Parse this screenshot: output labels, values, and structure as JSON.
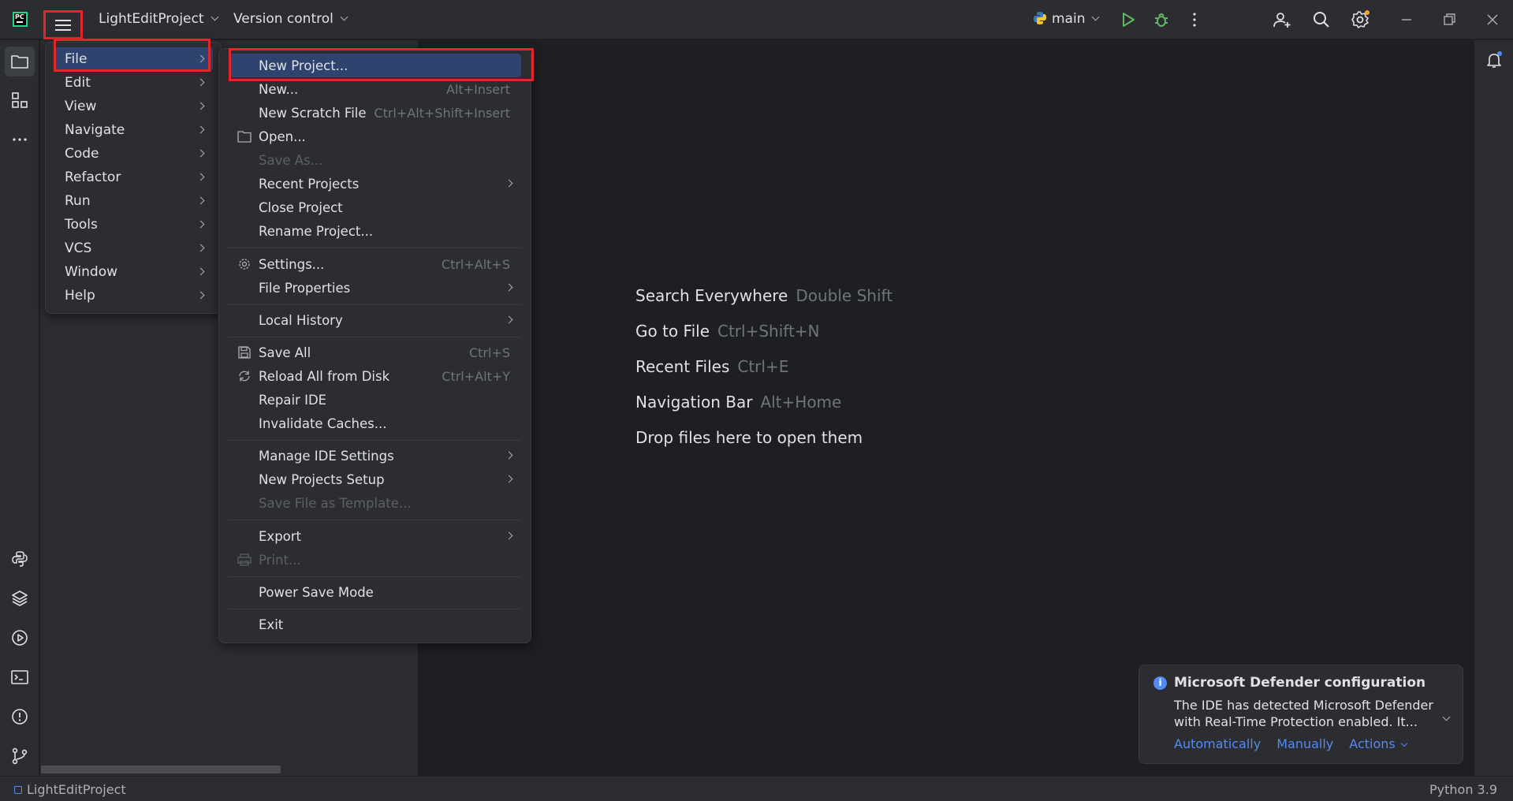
{
  "titlebar": {
    "project_name": "LightEditProject",
    "version_control": "Version control",
    "branch": "main"
  },
  "main_menu": {
    "items": [
      {
        "label": "File",
        "selected": true
      },
      {
        "label": "Edit"
      },
      {
        "label": "View"
      },
      {
        "label": "Navigate"
      },
      {
        "label": "Code"
      },
      {
        "label": "Refactor"
      },
      {
        "label": "Run"
      },
      {
        "label": "Tools"
      },
      {
        "label": "VCS"
      },
      {
        "label": "Window"
      },
      {
        "label": "Help"
      }
    ]
  },
  "file_menu": {
    "new_project": "New Project...",
    "new": "New...",
    "new_shortcut": "Alt+Insert",
    "new_scratch": "New Scratch File",
    "new_scratch_shortcut": "Ctrl+Alt+Shift+Insert",
    "open": "Open...",
    "save_as": "Save As...",
    "recent_projects": "Recent Projects",
    "close_project": "Close Project",
    "rename_project": "Rename Project...",
    "settings": "Settings...",
    "settings_shortcut": "Ctrl+Alt+S",
    "file_properties": "File Properties",
    "local_history": "Local History",
    "save_all": "Save All",
    "save_all_shortcut": "Ctrl+S",
    "reload": "Reload All from Disk",
    "reload_shortcut": "Ctrl+Alt+Y",
    "repair_ide": "Repair IDE",
    "invalidate_caches": "Invalidate Caches...",
    "manage_ide_settings": "Manage IDE Settings",
    "new_projects_setup": "New Projects Setup",
    "save_template": "Save File as Template...",
    "export": "Export",
    "print": "Print...",
    "power_save": "Power Save Mode",
    "exit": "Exit"
  },
  "editor_hints": [
    {
      "label": "Search Everywhere",
      "shortcut": "Double Shift"
    },
    {
      "label": "Go to File",
      "shortcut": "Ctrl+Shift+N"
    },
    {
      "label": "Recent Files",
      "shortcut": "Ctrl+E"
    },
    {
      "label": "Navigation Bar",
      "shortcut": "Alt+Home"
    },
    {
      "label": "Drop files here to open them",
      "shortcut": ""
    }
  ],
  "notification": {
    "title": "Microsoft Defender configuration",
    "body": "The IDE has detected Microsoft Defender with Real-Time Protection enabled. It...",
    "actions": [
      "Automatically",
      "Manually",
      "Actions"
    ]
  },
  "statusbar": {
    "project": "LightEditProject",
    "interpreter": "Python 3.9"
  },
  "colors": {
    "background": "#1e1f22",
    "panel": "#2b2d30",
    "selection": "#2e436e",
    "highlight_box": "#e3262c",
    "accent": "#548af7",
    "run_green": "#5fb865"
  }
}
